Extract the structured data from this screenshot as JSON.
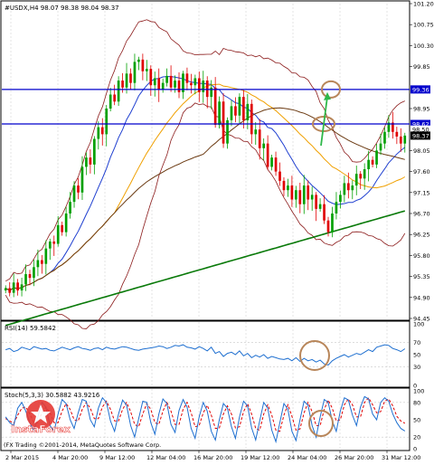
{
  "symbol_header": "#USDX,H4  98.07 98.38 98.04 98.37",
  "copyright": "(FX Trading ©2001-2014, MetaQuotes Software Corp.",
  "watermark": "InstaForex",
  "colors": {
    "candle_up": "#00a000",
    "candle_down": "#e00000",
    "bollinger": "#8b1a1a",
    "ma_blue": "#1f3fd0",
    "ma_orange": "#f0a000",
    "ma_brown": "#6b3a12",
    "ma_green": "#0a7a0a",
    "hline": "#0000cc",
    "rsi": "#1e6fd0",
    "stoch_main": "#1e6fd0",
    "stoch_signal": "#e00000",
    "circle": "#b8865a",
    "arrow": "#2fb84a",
    "grid": "#c8c8c8"
  },
  "chart_data": [
    {
      "type": "candlestick",
      "name": "USDX H4 price",
      "ylim": [
        94.45,
        101.2
      ],
      "y_ticks": [
        "101.20",
        "100.75",
        "100.30",
        "99.85",
        "99.40",
        "98.95",
        "98.50",
        "98.05",
        "97.60",
        "97.15",
        "96.70",
        "96.25",
        "95.80",
        "95.35",
        "94.90",
        "94.45"
      ],
      "x_ticks": [
        "2 Mar 2015",
        "4 Mar 20:00",
        "9 Mar 12:00",
        "12 Mar 04:00",
        "16 Mar 20:00",
        "19 Mar 12:00",
        "24 Mar 04:00",
        "26 Mar 20:00",
        "31 Mar 12:00"
      ],
      "close": [
        95.1,
        95.0,
        95.22,
        95.05,
        95.18,
        95.4,
        95.32,
        95.55,
        95.7,
        95.62,
        95.95,
        96.1,
        96.05,
        96.45,
        96.3,
        96.7,
        96.95,
        97.3,
        97.15,
        97.7,
        97.9,
        97.75,
        98.3,
        98.55,
        98.4,
        98.95,
        99.25,
        99.1,
        99.55,
        99.4,
        99.7,
        99.5,
        99.95,
        100.0,
        99.75,
        99.8,
        99.45,
        99.6,
        99.35,
        99.5,
        99.65,
        99.4,
        99.55,
        99.3,
        99.7,
        99.5,
        99.45,
        99.6,
        99.3,
        99.55,
        99.2,
        99.4,
        98.6,
        99.1,
        98.2,
        98.7,
        99.0,
        98.8,
        99.2,
        98.7,
        99.05,
        98.4,
        98.5,
        98.1,
        98.2,
        97.7,
        97.9,
        97.6,
        97.4,
        97.2,
        97.3,
        97.0,
        97.2,
        96.9,
        97.3,
        97.0,
        97.1,
        96.8,
        96.9,
        96.55,
        96.3,
        96.7,
        96.95,
        97.1,
        97.35,
        97.2,
        97.3,
        97.55,
        97.45,
        97.65,
        97.85,
        97.75,
        98.05,
        98.2,
        98.45,
        98.65,
        98.45,
        98.35,
        98.2,
        98.37
      ],
      "annotations": [
        {
          "type": "hline",
          "value": 99.36,
          "label": "99.36"
        },
        {
          "type": "hline",
          "value": 98.62,
          "label": "98.62"
        },
        {
          "type": "price_label",
          "value": 98.5,
          "label": "98.50"
        },
        {
          "type": "price_label",
          "value": 98.37,
          "label": "98.37"
        }
      ],
      "indicators": [
        "Bollinger Bands",
        "Moving Average (blue)",
        "Moving Average (orange)",
        "Moving Average (brown)",
        "Moving Average (green)"
      ]
    },
    {
      "type": "line",
      "name": "RSI(14)",
      "label": "RSI(14) 59.5842",
      "ylim": [
        0,
        100
      ],
      "y_ticks": [
        "100",
        "70",
        "50",
        "30",
        "0"
      ],
      "values": [
        58,
        60,
        55,
        57,
        62,
        60,
        58,
        63,
        61,
        59,
        60,
        57,
        56,
        59,
        62,
        60,
        58,
        61,
        63,
        60,
        59,
        57,
        60,
        61,
        58,
        62,
        60,
        59,
        61,
        63,
        62,
        60,
        58,
        57,
        59,
        60,
        61,
        62,
        64,
        63,
        60,
        62,
        65,
        64,
        66,
        62,
        61,
        59,
        63,
        60,
        56,
        62,
        52,
        55,
        47,
        52,
        54,
        50,
        56,
        48,
        52,
        45,
        49,
        46,
        50,
        44,
        47,
        45,
        43,
        42,
        44,
        40,
        45,
        39,
        44,
        40,
        42,
        38,
        41,
        35,
        33,
        40,
        44,
        47,
        50,
        46,
        49,
        52,
        50,
        54,
        58,
        55,
        62,
        64,
        66,
        65,
        60,
        58,
        55,
        59.58
      ]
    },
    {
      "type": "line",
      "name": "Stochastic",
      "label": "Stoch(5,3,3) 30.5882 43.9216",
      "ylim": [
        0,
        100
      ],
      "y_ticks": [
        "100",
        "80",
        "50",
        "20",
        "0"
      ],
      "series": [
        {
          "name": "main",
          "values": [
            55,
            45,
            40,
            70,
            80,
            65,
            45,
            30,
            55,
            80,
            72,
            40,
            30,
            60,
            85,
            78,
            50,
            35,
            62,
            85,
            82,
            50,
            38,
            70,
            88,
            80,
            48,
            30,
            60,
            84,
            75,
            40,
            20,
            52,
            82,
            80,
            45,
            25,
            60,
            86,
            78,
            42,
            28,
            66,
            85,
            72,
            35,
            18,
            55,
            80,
            65,
            30,
            15,
            50,
            78,
            70,
            38,
            18,
            55,
            82,
            74,
            36,
            15,
            48,
            80,
            70,
            32,
            12,
            45,
            78,
            68,
            30,
            14,
            50,
            82,
            75,
            40,
            20,
            55,
            85,
            80,
            48,
            30,
            65,
            88,
            84,
            58,
            40,
            72,
            90,
            86,
            60,
            50,
            80,
            88,
            82,
            60,
            45,
            35,
            30.59
          ]
        },
        {
          "name": "signal",
          "values": [
            52,
            48,
            44,
            58,
            70,
            72,
            60,
            45,
            45,
            62,
            72,
            62,
            45,
            45,
            65,
            78,
            68,
            50,
            48,
            68,
            80,
            70,
            52,
            52,
            72,
            82,
            68,
            48,
            48,
            68,
            80,
            64,
            42,
            38,
            60,
            78,
            68,
            45,
            42,
            65,
            80,
            65,
            42,
            42,
            68,
            80,
            62,
            38,
            40,
            62,
            75,
            58,
            35,
            36,
            60,
            74,
            60,
            36,
            38,
            64,
            78,
            60,
            35,
            32,
            60,
            76,
            58,
            32,
            30,
            58,
            76,
            56,
            32,
            34,
            62,
            80,
            64,
            40,
            40,
            68,
            84,
            70,
            48,
            50,
            76,
            86,
            76,
            55,
            55,
            80,
            88,
            76,
            62,
            64,
            82,
            86,
            74,
            56,
            48,
            43.92
          ]
        }
      ]
    }
  ]
}
